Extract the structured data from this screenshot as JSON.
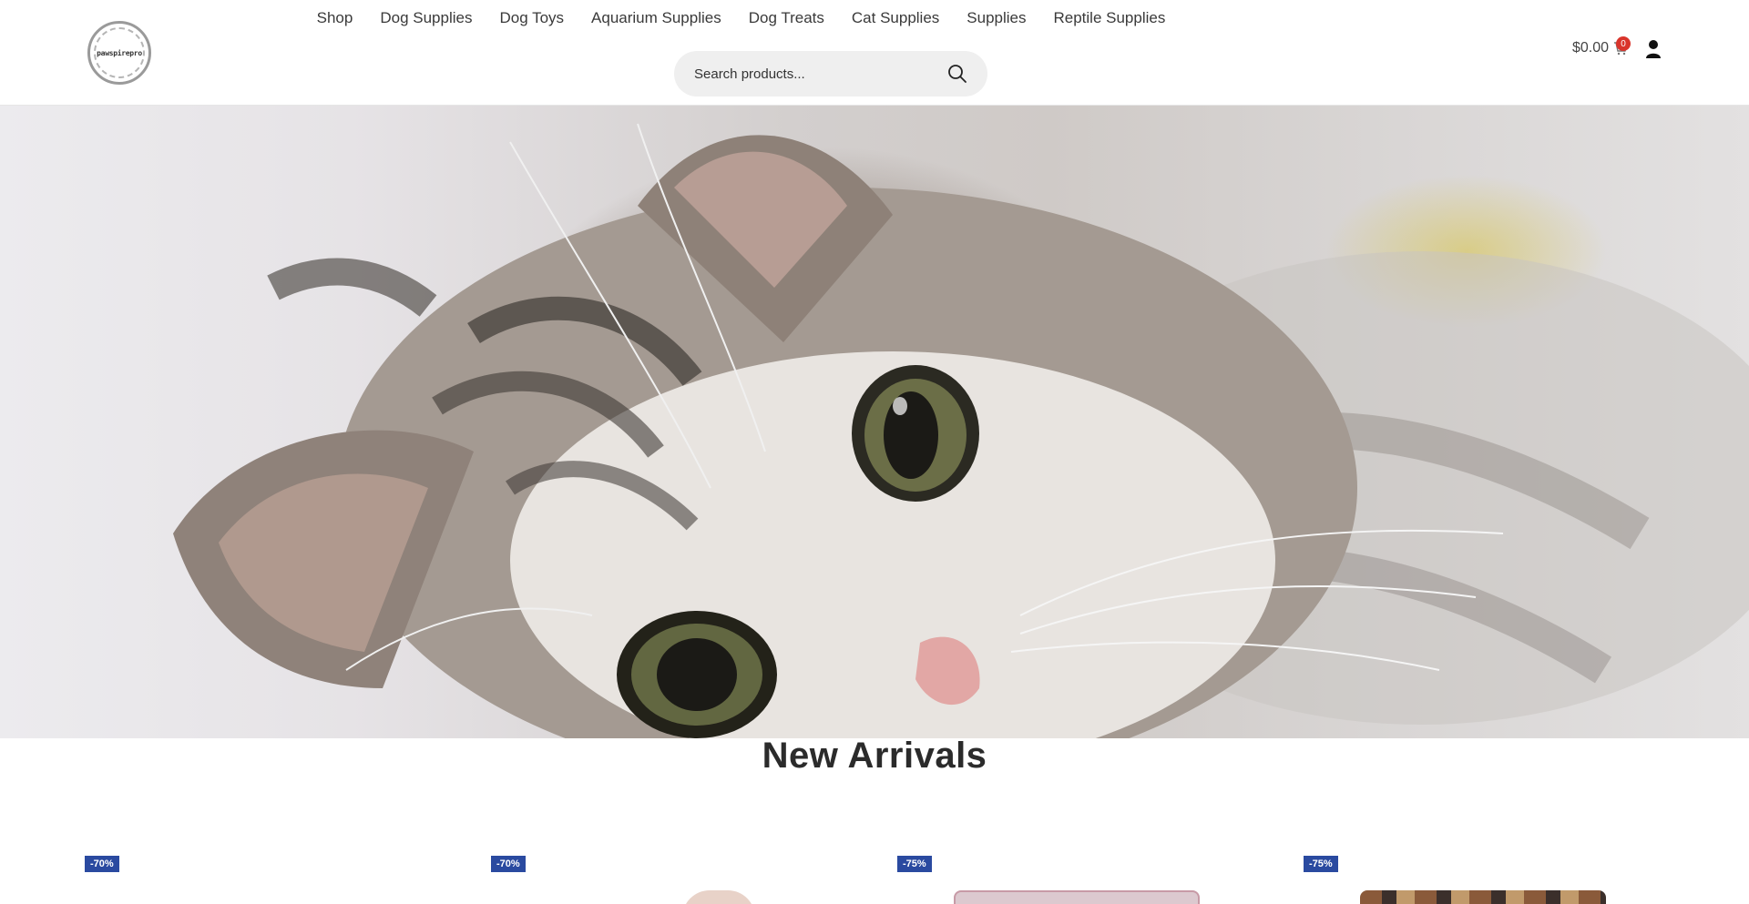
{
  "header": {
    "logo_text": "pawspirepro",
    "nav": [
      "Shop",
      "Dog Supplies",
      "Dog Toys",
      "Aquarium Supplies",
      "Dog Treats",
      "Cat Supplies",
      "Supplies",
      "Reptile Supplies"
    ],
    "search": {
      "placeholder": "Search products..."
    },
    "cart": {
      "total": "$0.00",
      "count": "0"
    }
  },
  "hero": {
    "image": "cat-photo"
  },
  "section": {
    "title": "New Arrivals"
  },
  "products": [
    {
      "badge": "-70%"
    },
    {
      "badge": "-70%"
    },
    {
      "badge": "-75%"
    },
    {
      "badge": "-75%"
    }
  ],
  "colors": {
    "badge": "#2a4aa0",
    "cart_badge": "#d9342b"
  }
}
